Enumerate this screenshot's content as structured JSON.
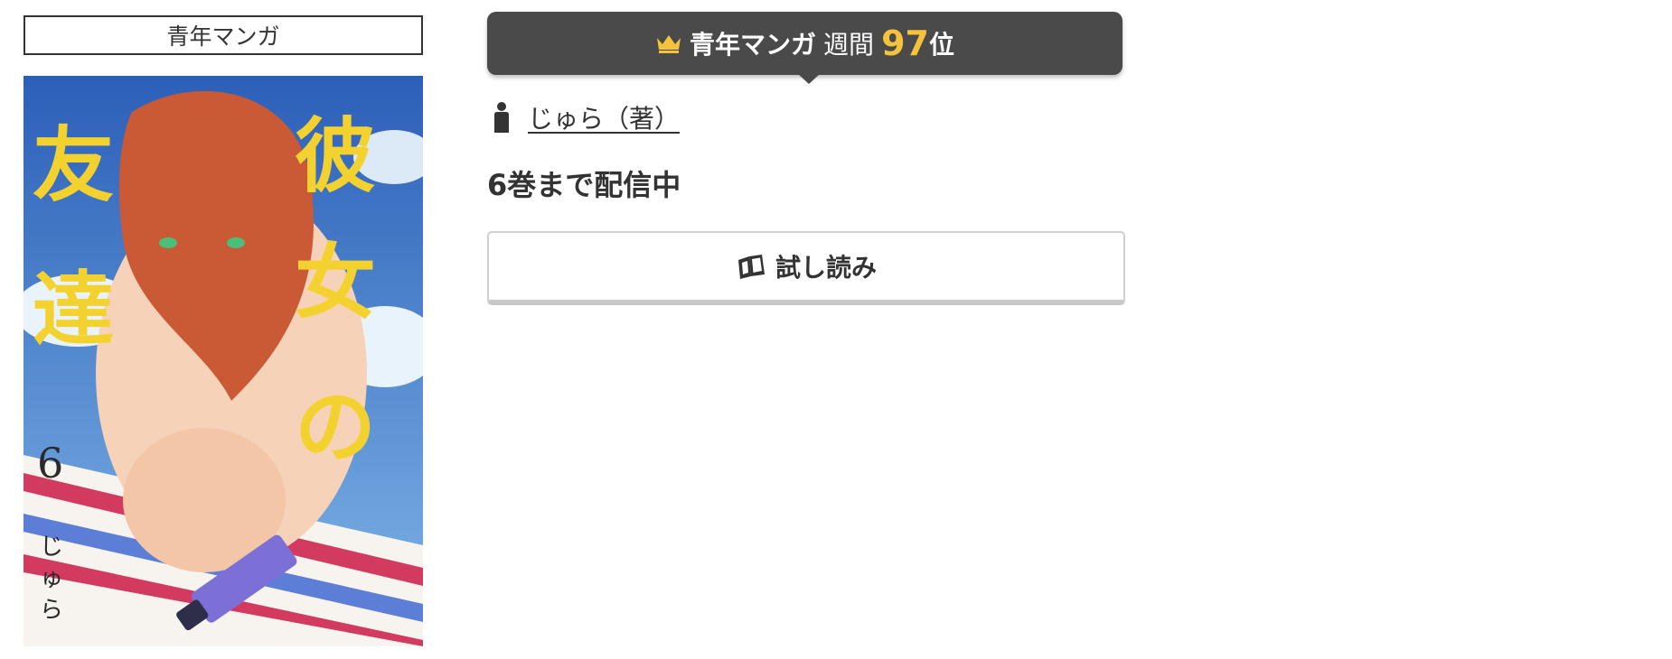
{
  "genre_label": "青年マンガ",
  "cover": {
    "title_text": "彼女の友達",
    "volume": "6",
    "author": "じゅら"
  },
  "ranking": {
    "genre": "青年マンガ",
    "period": "週間",
    "rank": "97",
    "suffix": "位",
    "crown_icon": "crown-icon",
    "accent_color": "#f5c23d",
    "banner_color": "#4a4a4a"
  },
  "author": {
    "label": "じゅら（著）",
    "icon": "person-icon"
  },
  "availability": "6巻まで配信中",
  "trial_button": {
    "label": "試し読み",
    "icon": "book-icon"
  }
}
